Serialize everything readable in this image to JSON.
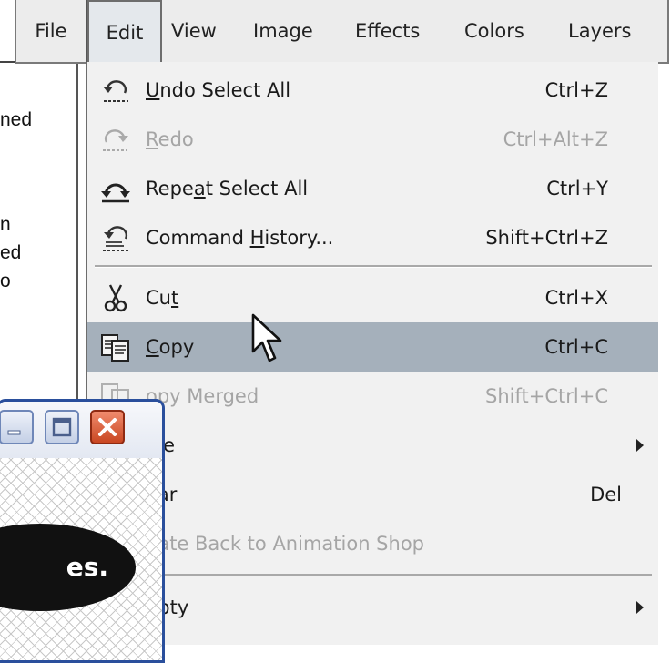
{
  "background_text": [
    "ned",
    "n",
    "ed",
    "o"
  ],
  "menubar": {
    "items": [
      "File",
      "Edit",
      "View",
      "Image",
      "Effects",
      "Colors",
      "Layers"
    ],
    "active": "Edit"
  },
  "edit_menu": {
    "items": [
      {
        "pre": "",
        "u": "U",
        "post": "ndo Select All",
        "shortcut": "Ctrl+Z",
        "icon": "undo-icon",
        "disabled": false
      },
      {
        "pre": "",
        "u": "R",
        "post": "edo",
        "shortcut": "Ctrl+Alt+Z",
        "icon": "redo-icon",
        "disabled": true
      },
      {
        "pre": "Repe",
        "u": "a",
        "post": "t Select All",
        "shortcut": "Ctrl+Y",
        "icon": "repeat-icon",
        "disabled": false
      },
      {
        "pre": "Command ",
        "u": "H",
        "post": "istory...",
        "shortcut": "Shift+Ctrl+Z",
        "icon": "command-history-icon",
        "disabled": false
      },
      {
        "pre": "Cu",
        "u": "t",
        "post": "",
        "shortcut": "Ctrl+X",
        "icon": "scissors-icon",
        "disabled": false
      },
      {
        "pre": "",
        "u": "C",
        "post": "opy",
        "shortcut": "Ctrl+C",
        "icon": "copy-icon",
        "disabled": false,
        "highlighted": true
      },
      {
        "pre": "",
        "u": "",
        "post": "opy Merged",
        "shortcut": "Shift+Ctrl+C",
        "icon": "copy-merged-icon",
        "disabled": true
      },
      {
        "pre": "",
        "u": "",
        "post": "ste",
        "shortcut": "",
        "icon": "",
        "disabled": false,
        "submenu": true
      },
      {
        "pre": "",
        "u": "",
        "post": "ear",
        "shortcut": "Del",
        "icon": "",
        "disabled": false
      },
      {
        "pre": "",
        "u": "",
        "post": "date Back to Animation Shop",
        "u_word": "B",
        "shortcut": "",
        "icon": "",
        "disabled": true
      },
      {
        "pre": "",
        "u": "",
        "post": "npty",
        "shortcut": "",
        "icon": "",
        "disabled": false,
        "submenu": true
      }
    ]
  },
  "image_window": {
    "logo_text": "es."
  },
  "colors": {
    "highlight": "#a5b0bb",
    "disabled_text": "#a5a5a5",
    "close_button": "#d9572f",
    "window_border": "#2a4f9c"
  }
}
